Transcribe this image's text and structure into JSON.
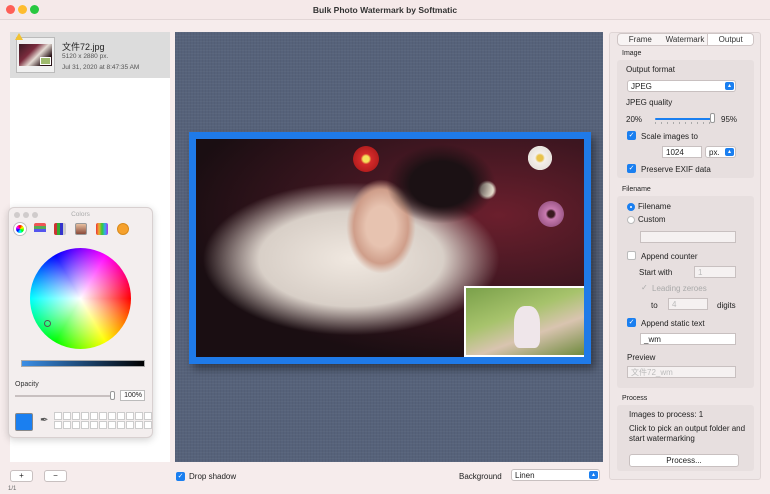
{
  "window": {
    "title": "Bulk Photo Watermark by Softmatic"
  },
  "files": [
    {
      "name": "文件72.jpg",
      "dimensions": "5120 x 2880 px.",
      "date": "Jul 31, 2020 at 8:47:35 AM"
    }
  ],
  "colors_panel": {
    "title": "Colors",
    "opacity_label": "Opacity",
    "opacity_value": "100%",
    "opacity_level": 1.0,
    "selected_color": "#1a7ff0"
  },
  "tabs": [
    "Frame",
    "Watermark",
    "Output"
  ],
  "active_tab": "Output",
  "image_section": {
    "label": "Image",
    "output_format_label": "Output format",
    "output_format": "JPEG",
    "quality_label": "JPEG quality",
    "quality_min": "20%",
    "quality_max": "95%",
    "quality_level": 0.95,
    "scale_label": "Scale images to",
    "scale_checked": true,
    "scale_value": "1024",
    "scale_unit": "px.",
    "preserve_exif_label": "Preserve EXIF data",
    "preserve_exif_checked": true
  },
  "filename_section": {
    "label": "Filename",
    "radio_filename": "Filename",
    "radio_custom": "Custom",
    "append_counter_label": "Append counter",
    "start_with_label": "Start with",
    "start_with_value": "1",
    "leading_zeroes_label": "Leading zeroes",
    "to_label": "to",
    "digits_value": "4",
    "digits_label": "digits",
    "append_static_label": "Append static text",
    "static_text_value": "_wm",
    "preview_label": "Preview",
    "preview_value": "文件72_wm"
  },
  "process_section": {
    "label": "Process",
    "images_to_process": "Images to process: 1",
    "instruction": "Click to pick an output folder and start watermarking",
    "button": "Process..."
  },
  "bottom_bar": {
    "add_button": "+",
    "remove_button": "−",
    "drop_shadow_label": "Drop shadow",
    "drop_shadow_checked": true,
    "background_label": "Background",
    "background_value": "Linen",
    "page_count": "1/1"
  },
  "accent_color": "#1a7ff0"
}
